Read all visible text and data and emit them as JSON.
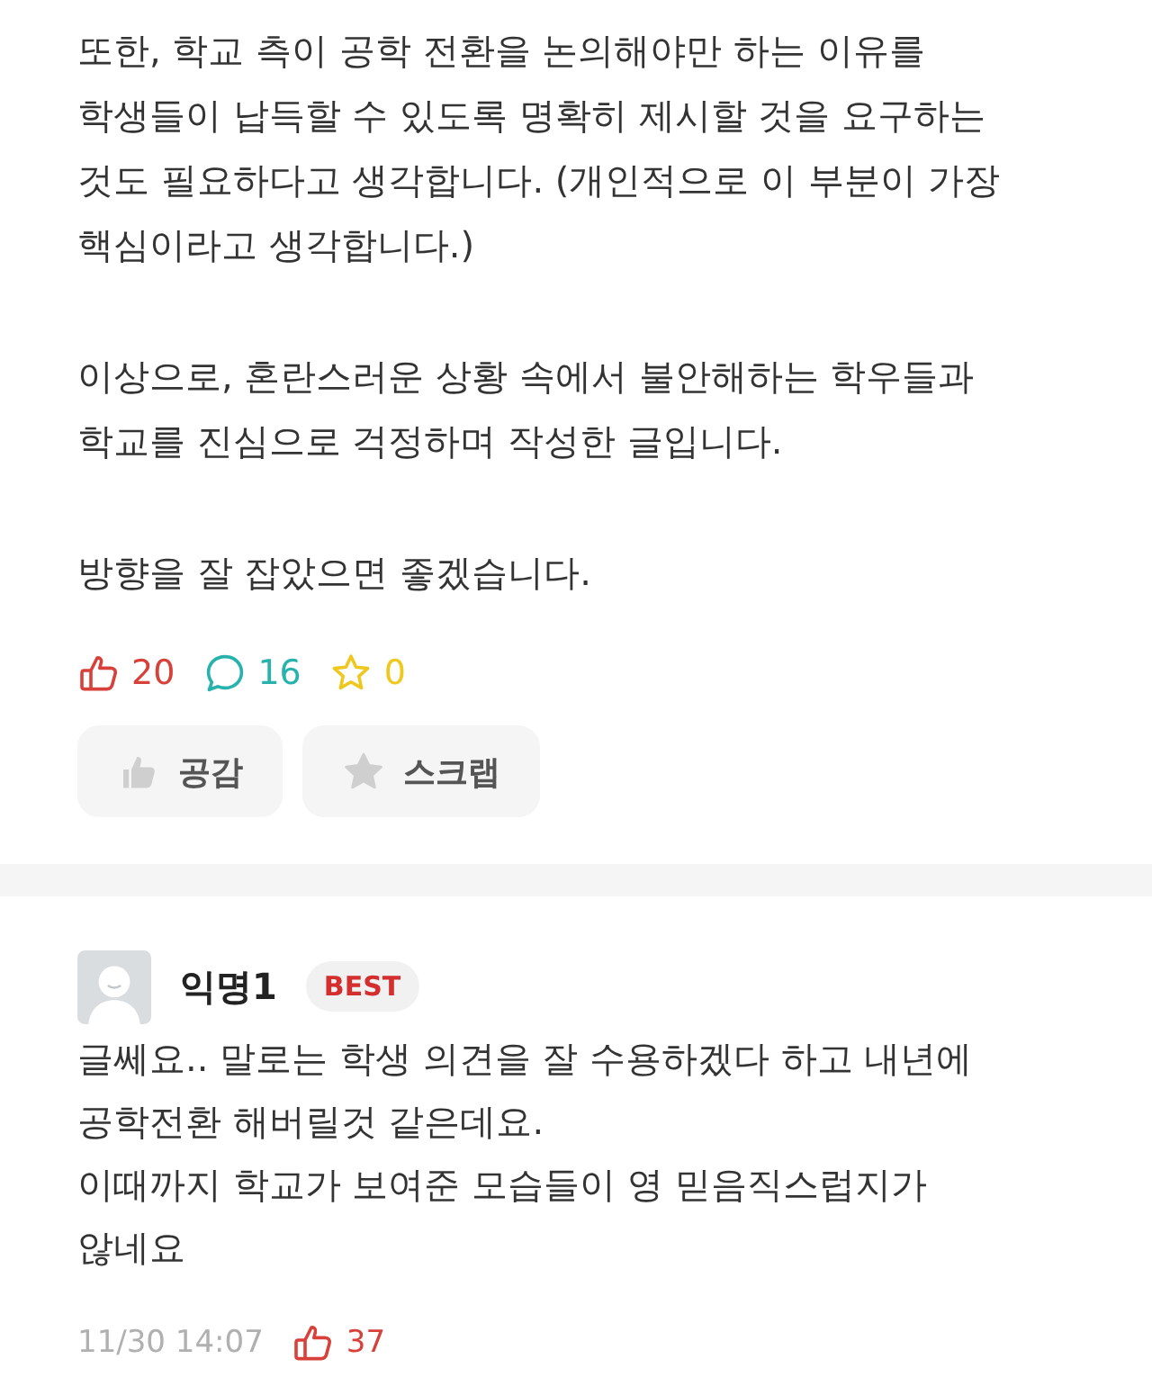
{
  "post": {
    "paragraphs": [
      "또한, 학교 측이 공학 전환을 논의해야만 하는 이유를\n학생들이 납득할 수 있도록 명확히 제시할 것을 요구하는\n것도 필요하다고 생각합니다. (개인적으로 이 부분이 가장\n핵심이라고 생각합니다.)",
      "이상으로, 혼란스러운 상황 속에서 불안해하는 학우들과\n학교를 진심으로 걱정하며 작성한 글입니다.",
      "방향을 잘 잡았으면 좋겠습니다."
    ],
    "stats": [
      {
        "kind": "like",
        "value": "20",
        "color": "#d8403a"
      },
      {
        "kind": "comment",
        "value": "16",
        "color": "#27b2ae"
      },
      {
        "kind": "scrap",
        "value": "0",
        "color": "#efc81f"
      }
    ],
    "actions": [
      {
        "kind": "like",
        "label": "공감"
      },
      {
        "kind": "scrap",
        "label": "스크랩"
      }
    ]
  },
  "comments": [
    {
      "author": "익명1",
      "badge": "BEST",
      "text": "글쎄요.. 말로는 학생 의견을 잘 수용하겠다 하고 내년에\n공학전환 해버릴것 같은데요.\n이때까지 학교가 보여준 모습들이 영 믿음직스럽지가\n않네요",
      "time": "11/30 14:07",
      "likes": "37"
    }
  ]
}
